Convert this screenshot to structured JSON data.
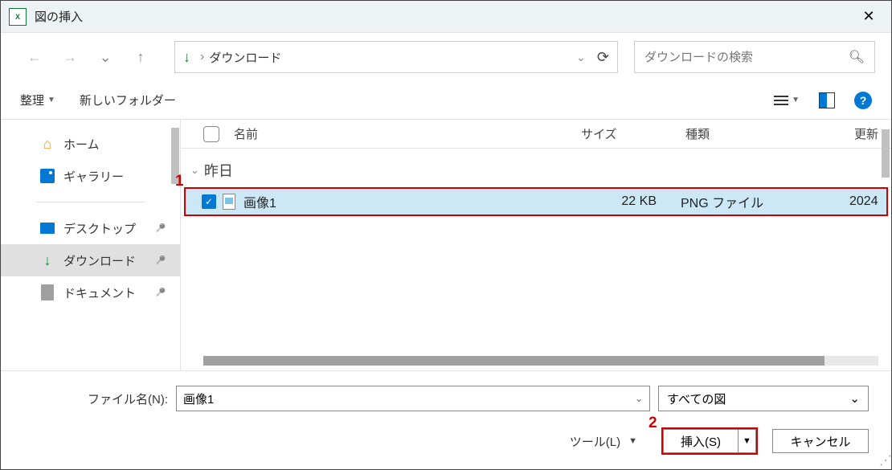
{
  "titlebar": {
    "app_icon_text": "X",
    "title": "図の挿入"
  },
  "navbar": {
    "path_label": "ダウンロード",
    "search_placeholder": "ダウンロードの検索"
  },
  "toolbar": {
    "organize_label": "整理",
    "new_folder_label": "新しいフォルダー"
  },
  "sidebar": {
    "home": "ホーム",
    "gallery": "ギャラリー",
    "desktop": "デスクトップ",
    "downloads": "ダウンロード",
    "documents": "ドキュメント"
  },
  "headers": {
    "name": "名前",
    "size": "サイズ",
    "type": "種類",
    "date": "更新"
  },
  "group": {
    "yesterday": "昨日"
  },
  "file": {
    "name": "画像1",
    "size": "22 KB",
    "type": "PNG ファイル",
    "date": "2024"
  },
  "bottom": {
    "filename_label": "ファイル名(N):",
    "filename_value": "画像1",
    "filter_label": "すべての図",
    "tools_label": "ツール(L)",
    "insert_label": "挿入(S)",
    "cancel_label": "キャンセル"
  },
  "annotations": {
    "one": "1",
    "two": "2"
  }
}
